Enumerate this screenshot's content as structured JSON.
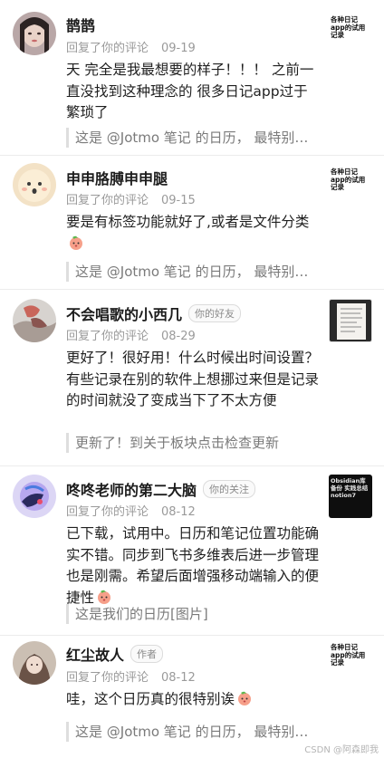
{
  "comments": [
    {
      "name": "鹊鹊",
      "tag": "",
      "meta": "回复了你的评论",
      "date": "09-19",
      "body": "天 完全是我最想要的样子！！！ 之前一直没找到这种理念的 很多日记app过于繁琐了",
      "quote": "这是 @Jotmo 笔记 的日历， 最特别…",
      "thumb": "各种日记app的试用记录"
    },
    {
      "name": "申申胳膊申申腿",
      "tag": "",
      "meta": "回复了你的评论",
      "date": "09-15",
      "body": "要是有标签功能就好了,或者是文件分类",
      "quote": "这是 @Jotmo 笔记 的日历， 最特别…",
      "thumb": "各种日记app的试用记录"
    },
    {
      "name": "不会唱歌的小西几",
      "tag": "你的好友",
      "meta": "回复了你的评论",
      "date": "08-29",
      "body": "更好了！很好用！什么时候出时间设置？有些记录在别的软件上想挪过来但是记录的时间就没了变成当下了不太方便",
      "quote": "更新了！到关于板块点击检查更新",
      "thumb": ""
    },
    {
      "name": "咚咚老师的第二大脑",
      "tag": "你的关注",
      "meta": "回复了你的评论",
      "date": "08-12",
      "body": "已下载，试用中。日历和笔记位置功能确实不错。同步到飞书多维表后进一步管理也是刚需。希望后面增强移动端输入的便捷性",
      "quote": "这是我们的日历[图片]",
      "thumb": "Obsidian库 备份 实践总结 notion7"
    },
    {
      "name": "红尘故人",
      "tag": "作者",
      "meta": "回复了你的评论",
      "date": "08-12",
      "body": "哇，这个日历真的很特别诶",
      "quote": "这是 @Jotmo 笔记 的日历， 最特别…",
      "thumb": "各种日记app的试用记录"
    }
  ],
  "watermark": "CSDN @阿森即我"
}
